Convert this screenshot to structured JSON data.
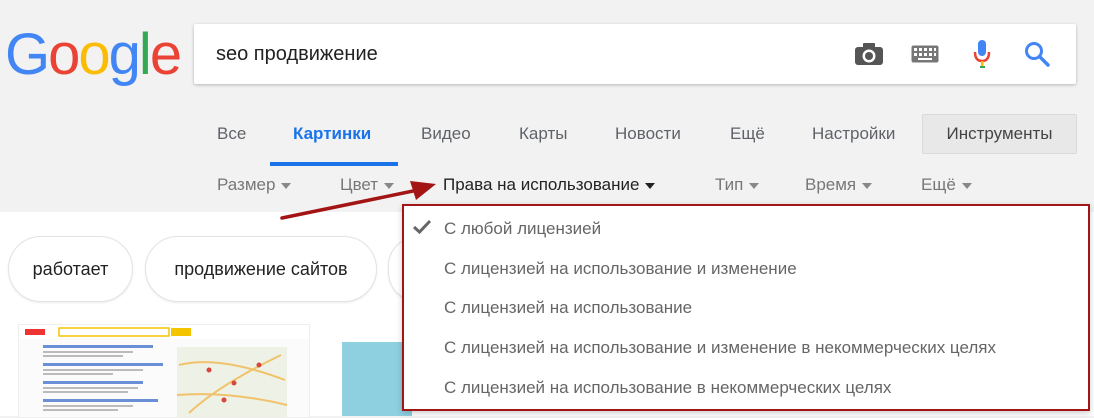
{
  "logo": {
    "letters": [
      "G",
      "o",
      "o",
      "g",
      "l",
      "e"
    ],
    "colors": [
      "#4285f4",
      "#ea4335",
      "#fbbc05",
      "#4285f4",
      "#34a853",
      "#ea4335"
    ]
  },
  "search": {
    "value": "seo продвижение",
    "icons": [
      "camera-icon",
      "keyboard-icon",
      "microphone-icon",
      "search-icon"
    ]
  },
  "tabs": [
    {
      "label": "Все"
    },
    {
      "label": "Картинки",
      "active": true
    },
    {
      "label": "Видео"
    },
    {
      "label": "Карты"
    },
    {
      "label": "Новости"
    },
    {
      "label": "Ещё"
    },
    {
      "label": "Настройки"
    }
  ],
  "tools_label": "Инструменты",
  "filters": [
    {
      "label": "Размер"
    },
    {
      "label": "Цвет"
    },
    {
      "label": "Права на использование",
      "active": true
    },
    {
      "label": "Тип"
    },
    {
      "label": "Время"
    },
    {
      "label": "Ещё"
    }
  ],
  "chips": [
    "работает",
    "продвижение сайтов"
  ],
  "license_menu": {
    "options": [
      {
        "label": "С любой лицензией",
        "selected": true
      },
      {
        "label": "С лицензией на использование и изменение"
      },
      {
        "label": "С лицензией на использование"
      },
      {
        "label": "С лицензией на использование и изменение в некоммерческих целях"
      },
      {
        "label": "С лицензией на использование в некоммерческих целях"
      }
    ]
  },
  "colors": {
    "accent": "#1a73e8",
    "annotation": "#a31515"
  }
}
